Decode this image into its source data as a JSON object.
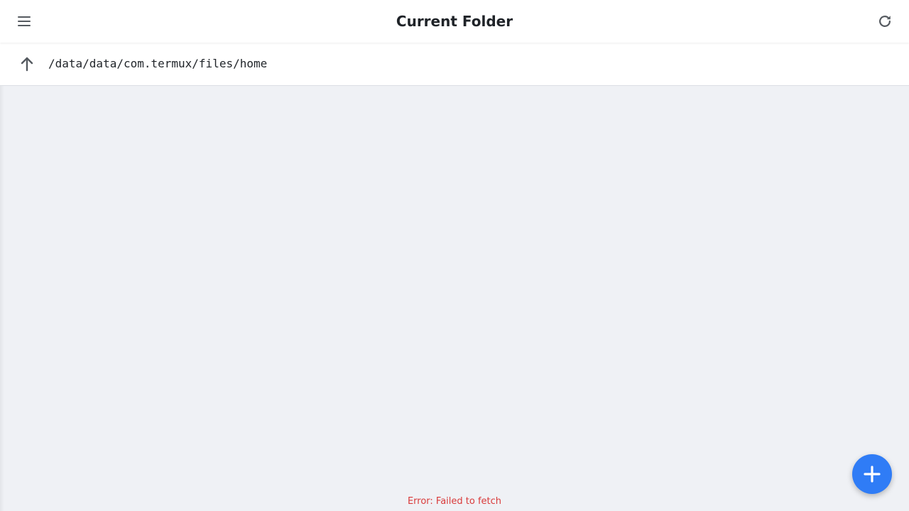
{
  "header": {
    "title": "Current Folder",
    "menu_icon": "hamburger-menu-icon",
    "refresh_icon": "refresh-icon"
  },
  "pathbar": {
    "up_icon": "arrow-up-icon",
    "path": "/data/data/com.termux/files/home"
  },
  "file_list": {
    "items": []
  },
  "status": {
    "error": "Error: Failed to fetch"
  },
  "fab": {
    "icon": "plus-icon"
  },
  "colors": {
    "accent": "#2f7cf6",
    "background": "#eff1f5",
    "error": "#d93a3a",
    "icon": "#555a60",
    "text": "#1f2328"
  }
}
